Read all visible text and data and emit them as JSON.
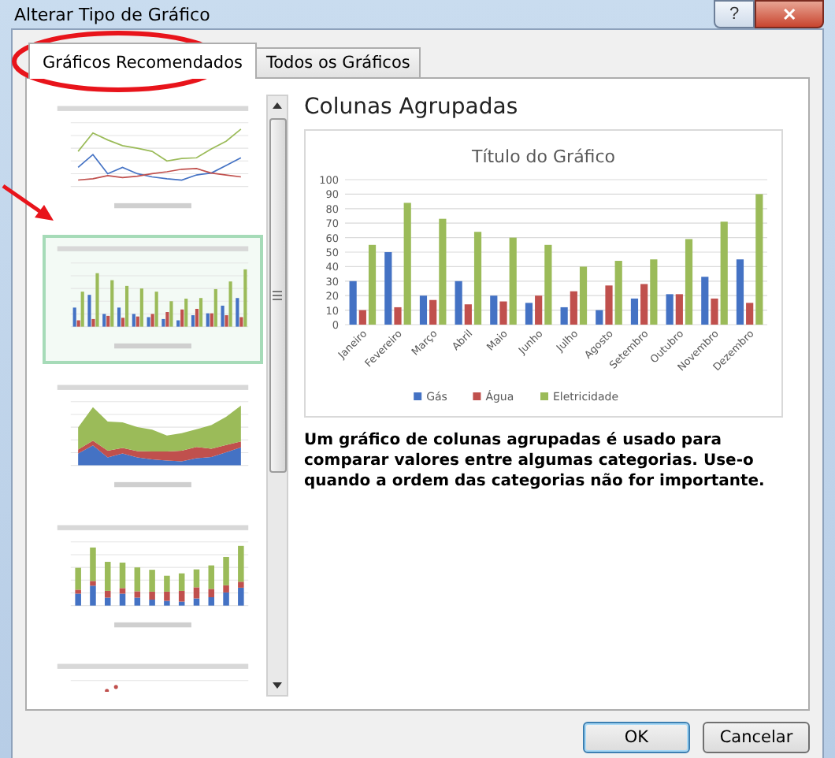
{
  "window": {
    "title": "Alterar Tipo de Gráfico",
    "help_button": "?",
    "close_button": "✕"
  },
  "tabs": [
    {
      "label": "Gráficos Recomendados",
      "selected": true
    },
    {
      "label": "Todos os Gráficos",
      "selected": false
    }
  ],
  "thumbnails": [
    {
      "kind": "line",
      "selected": false
    },
    {
      "kind": "bar",
      "selected": true
    },
    {
      "kind": "area",
      "selected": false
    },
    {
      "kind": "stacked",
      "selected": false
    },
    {
      "kind": "scatter",
      "selected": false
    }
  ],
  "preview": {
    "heading": "Colunas Agrupadas",
    "chart_data": {
      "type": "bar",
      "title": "Título do Gráfico",
      "categories": [
        "Janeiro",
        "Fevereiro",
        "Março",
        "Abril",
        "Maio",
        "Junho",
        "Julho",
        "Agosto",
        "Setembro",
        "Outubro",
        "Novembro",
        "Dezembro"
      ],
      "series": [
        {
          "name": "Gás",
          "color": "#4472c4",
          "values": [
            30,
            50,
            20,
            30,
            20,
            15,
            12,
            10,
            18,
            21,
            33,
            45
          ]
        },
        {
          "name": "Água",
          "color": "#c0504d",
          "values": [
            10,
            12,
            17,
            14,
            16,
            20,
            23,
            27,
            28,
            21,
            18,
            15
          ]
        },
        {
          "name": "Eletricidade",
          "color": "#9bbb59",
          "values": [
            55,
            84,
            73,
            64,
            60,
            55,
            40,
            44,
            45,
            59,
            71,
            90
          ]
        }
      ],
      "grid": true,
      "legend": true,
      "ylim": [
        0,
        100
      ],
      "yticks": [
        0,
        10,
        20,
        30,
        40,
        50,
        60,
        70,
        80,
        90,
        100
      ]
    },
    "description": "Um gráfico de colunas agrupadas é usado para comparar valores entre algumas categorias. Use-o quando a ordem das categorias não for importante."
  },
  "buttons": [
    {
      "label": "OK",
      "kind": "default"
    },
    {
      "label": "Cancelar",
      "kind": "normal"
    }
  ]
}
